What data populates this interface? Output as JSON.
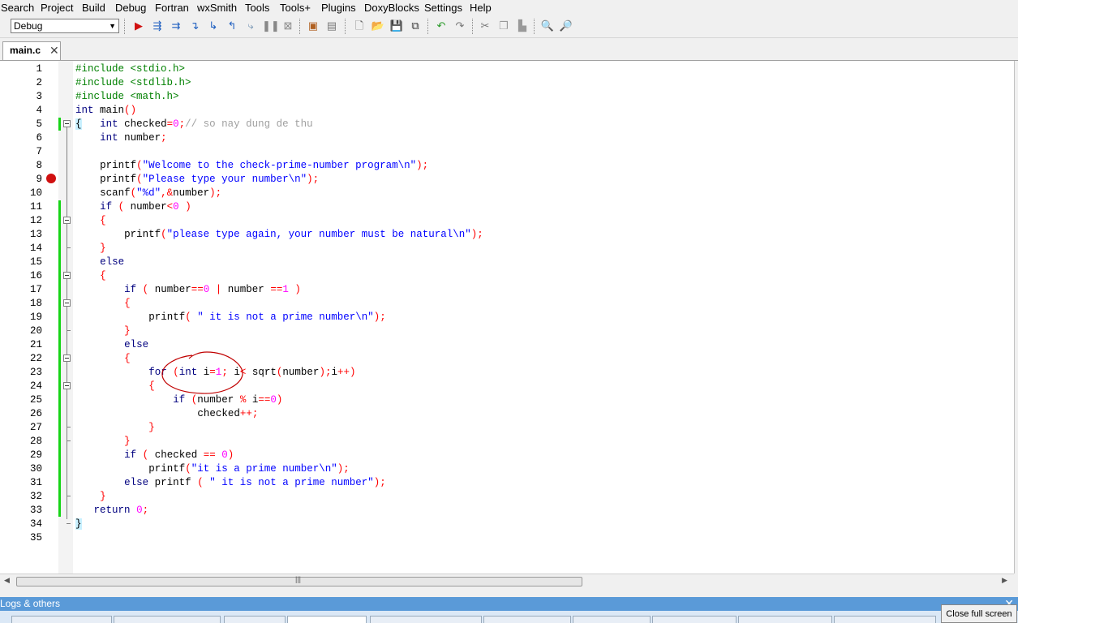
{
  "menubar": {
    "items": [
      "Search",
      "Project",
      "Build",
      "Debug",
      "Fortran",
      "wxSmith",
      "Tools",
      "Tools+",
      "Plugins",
      "DoxyBlocks",
      "Settings",
      "Help"
    ]
  },
  "toolbar": {
    "build_target": "Debug"
  },
  "editor": {
    "tab_label": "main.c",
    "tab_close": "✕",
    "line_numbers": [
      "1",
      "2",
      "3",
      "4",
      "5",
      "6",
      "7",
      "8",
      "9",
      "10",
      "11",
      "12",
      "13",
      "14",
      "15",
      "16",
      "17",
      "18",
      "19",
      "20",
      "21",
      "22",
      "23",
      "24",
      "25",
      "26",
      "27",
      "28",
      "29",
      "30",
      "31",
      "32",
      "33",
      "34",
      "35"
    ],
    "lines": [
      "#include <stdio.h>",
      "#include <stdlib.h>",
      "#include <math.h>",
      "int main()",
      "{   int checked=0;// so nay dung de thu",
      "    int number;",
      "",
      "    printf(\"Welcome to the check-prime-number program\\n\");",
      "    printf(\"Please type your number\\n\");",
      "    scanf(\"%d\",&number);",
      "    if ( number<0 )",
      "    {",
      "        printf(\"please type again, your number must be natural\\n\");",
      "    }",
      "    else",
      "    {",
      "        if ( number==0 | number ==1 )",
      "        {",
      "            printf( \" it is not a prime number\\n\");",
      "        }",
      "        else",
      "        {",
      "            for (int i=1; i< sqrt(number);i++)",
      "            {",
      "                if (number % i==0)",
      "                    checked++;",
      "            }",
      "        }",
      "        if ( checked == 0)",
      "            printf(\"it is a prime number\\n\");",
      "        else printf ( \" it is not a prime number\");",
      "    }",
      "   return 0;",
      "}",
      ""
    ]
  },
  "logs": {
    "title": "Logs & others",
    "close_icon": "✕"
  },
  "close_fullscreen": {
    "label": "Close full screen"
  },
  "colors": {
    "keyword": "#00007f",
    "string": "#0000ff",
    "preprocessor": "#008000",
    "operator": "#ff0000",
    "number": "#ff00ff",
    "comment": "#a0a0a0",
    "change_bar": "#17d417",
    "breakpoint": "#d01010",
    "logs_title_bar": "#5a9ad8"
  },
  "icons": {
    "toolbar": [
      "run-icon",
      "debug-run-icon",
      "run-to-cursor-icon",
      "next-line-icon",
      "step-into-icon",
      "step-out-icon",
      "next-instruction-icon",
      "pause-icon",
      "stop-icon",
      "debug-windows-icon",
      "info-icon",
      "new-file-icon",
      "open-icon",
      "save-icon",
      "save-all-icon",
      "undo-icon",
      "redo-icon",
      "cut-icon",
      "copy-icon",
      "paste-icon",
      "find-icon",
      "replace-icon"
    ]
  },
  "gutter": {
    "breakpoint_line": 9,
    "fold_lines": [
      5,
      12,
      16,
      18,
      22,
      24
    ]
  }
}
